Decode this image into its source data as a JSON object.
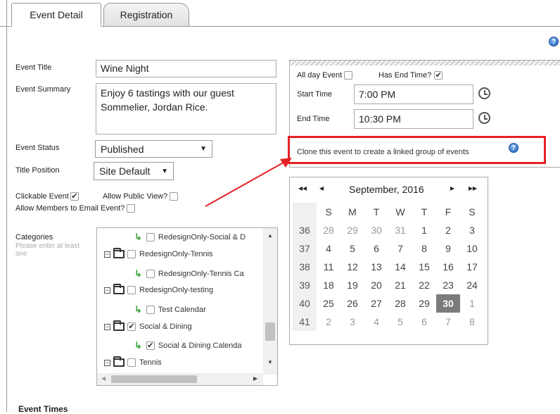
{
  "tabs": [
    {
      "label": "Event Detail"
    },
    {
      "label": "Registration"
    }
  ],
  "form": {
    "event_title": {
      "label": "Event Title",
      "value": "Wine Night"
    },
    "event_summary": {
      "label": "Event Summary",
      "value": "Enjoy 6 tastings with our guest Sommelier, Jordan Rice."
    },
    "event_status": {
      "label": "Event Status",
      "value": "Published"
    },
    "title_position": {
      "label": "Title Position",
      "value": "Site Default"
    },
    "clickable_event": {
      "label": "Clickable Event",
      "checked": true
    },
    "allow_public_view": {
      "label": "Allow Public View?",
      "checked": false
    },
    "allow_members_email": {
      "label": "Allow Members to Email Event?",
      "checked": false
    },
    "categories": {
      "label": "Categories",
      "note": "Please enter at least one"
    }
  },
  "time": {
    "all_day_label": "All day Event",
    "has_end_label": "Has End Time?",
    "start_label": "Start Time",
    "start_value": "7:00 PM",
    "end_label": "End Time",
    "end_value": "10:30 PM",
    "clone_text": "Clone this event to create a linked group of events"
  },
  "calendar": {
    "month": "September, 2016",
    "nav": {
      "prev_year": "◂◂",
      "prev": "◂",
      "next": "▸",
      "next_year": "▸▸"
    },
    "days": [
      "S",
      "M",
      "T",
      "W",
      "T",
      "F",
      "S"
    ],
    "weeks": [
      {
        "wk": "36",
        "d": [
          "28",
          "29",
          "30",
          "31",
          "1",
          "2",
          "3"
        ]
      },
      {
        "wk": "37",
        "d": [
          "4",
          "5",
          "6",
          "7",
          "8",
          "9",
          "10"
        ]
      },
      {
        "wk": "38",
        "d": [
          "11",
          "12",
          "13",
          "14",
          "15",
          "16",
          "17"
        ]
      },
      {
        "wk": "39",
        "d": [
          "18",
          "19",
          "20",
          "21",
          "22",
          "23",
          "24"
        ]
      },
      {
        "wk": "40",
        "d": [
          "25",
          "26",
          "27",
          "28",
          "29",
          "30",
          "1"
        ]
      },
      {
        "wk": "41",
        "d": [
          "2",
          "3",
          "4",
          "5",
          "6",
          "7",
          "8"
        ]
      }
    ],
    "selected": "30"
  },
  "tree": [
    {
      "label": "RedesignOnly-Social & D",
      "checked": false
    },
    {
      "label": "RedesignOnly-Tennis",
      "checked": false
    },
    {
      "label": "RedesignOnly-Tennis Ca",
      "checked": false
    },
    {
      "label": "RedesignOnly-testing",
      "checked": false
    },
    {
      "label": "Test Calendar",
      "checked": false
    },
    {
      "label": "Social & Dining",
      "checked": true
    },
    {
      "label": "Social & Dining Calenda",
      "checked": true
    },
    {
      "label": "Tennis",
      "checked": false
    }
  ],
  "section_footer": "Event Times",
  "colors": {
    "accent_red": "#e52226",
    "help_blue": "#1f5fbf",
    "tree_arrow": "#3aa33a"
  }
}
